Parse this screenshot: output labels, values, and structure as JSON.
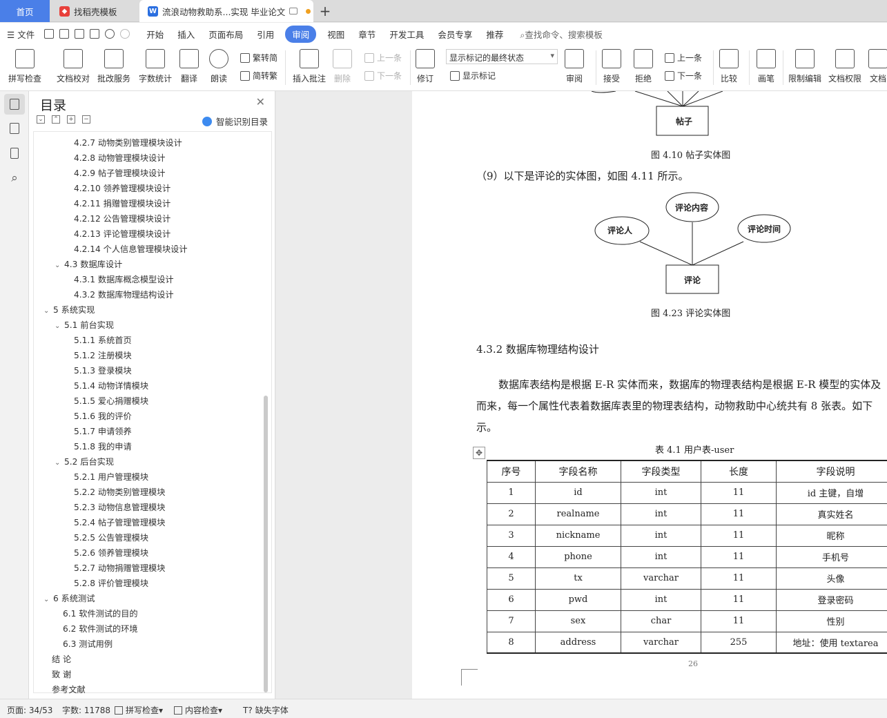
{
  "tabs": {
    "home": "首页",
    "template": "找稻壳模板",
    "doc": "流浪动物救助系...实现 毕业论文"
  },
  "menu": {
    "file": "文件",
    "items": [
      "开始",
      "插入",
      "页面布局",
      "引用",
      "审阅",
      "视图",
      "章节",
      "开发工具",
      "会员专享",
      "推荐"
    ],
    "active": "审阅",
    "search": "查找命令、搜索模板"
  },
  "ribbon": {
    "spell": "拼写检查",
    "proof": "文档校对",
    "batch": "批改服务",
    "wordcount": "字数统计",
    "translate": "翻译",
    "read": "朗读",
    "to_trad": "繁转简",
    "to_simp": "简转繁",
    "insert_comment": "插入批注",
    "delete": "删除",
    "prev": "上一条",
    "next": "下一条",
    "revise": "修订",
    "markup_state": "显示标记的最终状态",
    "show_markup": "显示标记",
    "review": "审阅",
    "accept": "接受",
    "reject": "拒绝",
    "prev2": "上一条",
    "next2": "下一条",
    "compare": "比较",
    "pen": "画笔",
    "restrict": "限制编辑",
    "rights": "文档权限",
    "doc_cut": "文档"
  },
  "toc": {
    "title": "目录",
    "smart": "智能识别目录",
    "items": [
      {
        "text": "4.2.7 动物类别管理模块设计",
        "level": 3
      },
      {
        "text": "4.2.8 动物管理模块设计",
        "level": 3
      },
      {
        "text": "4.2.9 帖子管理模块设计",
        "level": 3
      },
      {
        "text": "4.2.10 领养管理模块设计",
        "level": 3
      },
      {
        "text": "4.2.11 捐赠管理模块设计",
        "level": 3
      },
      {
        "text": "4.2.12 公告管理模块设计",
        "level": 3
      },
      {
        "text": "4.2.13 评论管理模块设计",
        "level": 3
      },
      {
        "text": "4.2.14 个人信息管理模块设计",
        "level": 3
      },
      {
        "text": "4.3  数据库设计",
        "level": 2,
        "expand": true
      },
      {
        "text": "4.3.1 数据库概念模型设计",
        "level": 3
      },
      {
        "text": "4.3.2 数据库物理结构设计",
        "level": 3
      },
      {
        "text": "5  系统实现",
        "level": 1,
        "expand": true
      },
      {
        "text": "5.1  前台实现",
        "level": 2,
        "expand": true
      },
      {
        "text": "5.1.1  系统首页",
        "level": 3
      },
      {
        "text": "5.1.2  注册模块",
        "level": 3
      },
      {
        "text": "5.1.3 登录模块",
        "level": 3
      },
      {
        "text": "5.1.4 动物详情模块",
        "level": 3
      },
      {
        "text": "5.1.5 爱心捐赠模块",
        "level": 3
      },
      {
        "text": "5.1.6  我的评价",
        "level": 3
      },
      {
        "text": "5.1.7  申请领养",
        "level": 3
      },
      {
        "text": "5.1.8  我的申请",
        "level": 3
      },
      {
        "text": "5.2  后台实现",
        "level": 2,
        "expand": true
      },
      {
        "text": "5.2.1  用户管理模块",
        "level": 3
      },
      {
        "text": "5.2.2  动物类别管理模块",
        "level": 3
      },
      {
        "text": "5.2.3  动物信息管理模块",
        "level": 3
      },
      {
        "text": "5.2.4  帖子管理管理模块",
        "level": 3
      },
      {
        "text": "5.2.5  公告管理模块",
        "level": 3
      },
      {
        "text": "5.2.6  领养管理模块",
        "level": 3
      },
      {
        "text": "5.2.7  动物捐赠管理模块",
        "level": 3
      },
      {
        "text": "5.2.8  评价管理模块",
        "level": 3
      },
      {
        "text": "6  系统测试",
        "level": 1,
        "expand": true
      },
      {
        "text": "6.1  软件测试的目的",
        "level": 2
      },
      {
        "text": "6.2  软件测试的环境",
        "level": 2
      },
      {
        "text": "6.3  测试用例",
        "level": 2
      },
      {
        "text": "结    论",
        "level": 1
      },
      {
        "text": "致    谢",
        "level": 1
      },
      {
        "text": "参考文献",
        "level": 1
      }
    ]
  },
  "doc": {
    "entity_post": "帖子",
    "caption_410": "图 4.10  帖子实体图",
    "para_9": "（9）以下是评论的实体图，如图 4.11 所示。",
    "er_comment": {
      "entity": "评论",
      "attr1": "评论人",
      "attr2": "评论内容",
      "attr3": "评论时间"
    },
    "caption_423": "图 4.23  评论实体图",
    "heading": "4.3.2 数据库物理结构设计",
    "body1": "数据库表结构是根据 E-R 实体而来，数据库的物理表结构是根据 E-R 模型的实体及",
    "body2": "而来，每一个属性代表着数据库表里的物理表结构，动物救助中心统共有 8 张表。如下",
    "body3": "示。",
    "table_caption": "表 4.1 用户表-user",
    "table": {
      "headers": [
        "序号",
        "字段名称",
        "字段类型",
        "长度",
        "字段说明"
      ],
      "rows": [
        [
          "1",
          "id",
          "int",
          "11",
          "id 主键，自增"
        ],
        [
          "2",
          "realname",
          "int",
          "11",
          "真实姓名"
        ],
        [
          "3",
          "nickname",
          "int",
          "11",
          "昵称"
        ],
        [
          "4",
          "phone",
          "int",
          "11",
          "手机号"
        ],
        [
          "5",
          "tx",
          "varchar",
          "11",
          "头像"
        ],
        [
          "6",
          "pwd",
          "int",
          "11",
          "登录密码"
        ],
        [
          "7",
          "sex",
          "char",
          "11",
          "性别"
        ],
        [
          "8",
          "address",
          "varchar",
          "255",
          "地址：使用 textarea"
        ]
      ]
    },
    "page_number": "26"
  },
  "status": {
    "page": "页面: 34/53",
    "words": "字数: 11788",
    "spell": "拼写检查",
    "content": "内容检查",
    "missing_font": "缺失字体"
  },
  "colors": {
    "accent": "#4a7fe8",
    "wps_red": "#e8403a",
    "wps_blue": "#2b6fe0"
  }
}
